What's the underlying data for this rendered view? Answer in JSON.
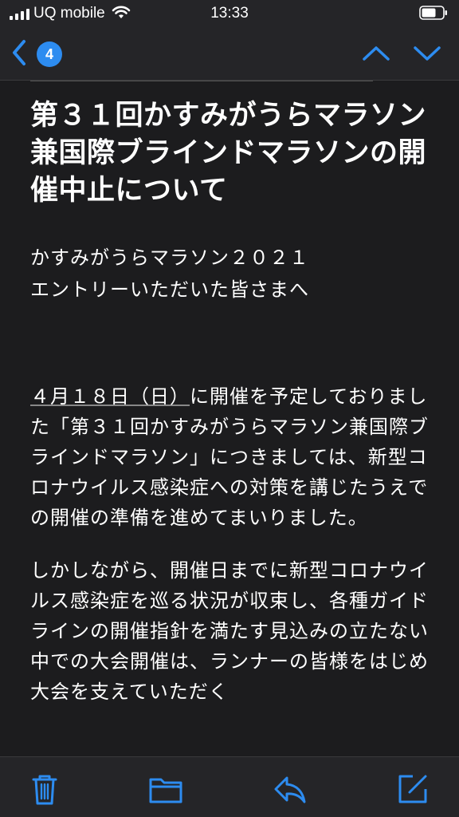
{
  "status_bar": {
    "carrier": "UQ mobile",
    "time": "13:33"
  },
  "nav": {
    "unread_count": "4",
    "accent_color": "#2d8cf0"
  },
  "email": {
    "title": "第３１回かすみがうらマラソン兼国際ブラインドマラソンの開催中止について",
    "greeting_line1": "かすみがうらマラソン２０２１",
    "greeting_line2": "エントリーいただいた皆さまへ",
    "para1_date": "４月１８日（日）",
    "para1_rest": "に開催を予定しておりました「第３１回かすみがうらマラソン兼国際ブラインドマラソン」につきましては、新型コロナウイルス感染症への対策を講じたうえでの開催の準備を進めてまいりました。",
    "para2": "しかしながら、開催日までに新型コロナウイルス感染症を巡る状況が収束し、各種ガイドラインの開催指針を満たす見込みの立たない中での大会開催は、ランナーの皆様をはじめ大会を支えていただく"
  },
  "toolbar": {
    "icons": [
      "trash-icon",
      "folder-icon",
      "reply-icon",
      "compose-icon"
    ]
  }
}
